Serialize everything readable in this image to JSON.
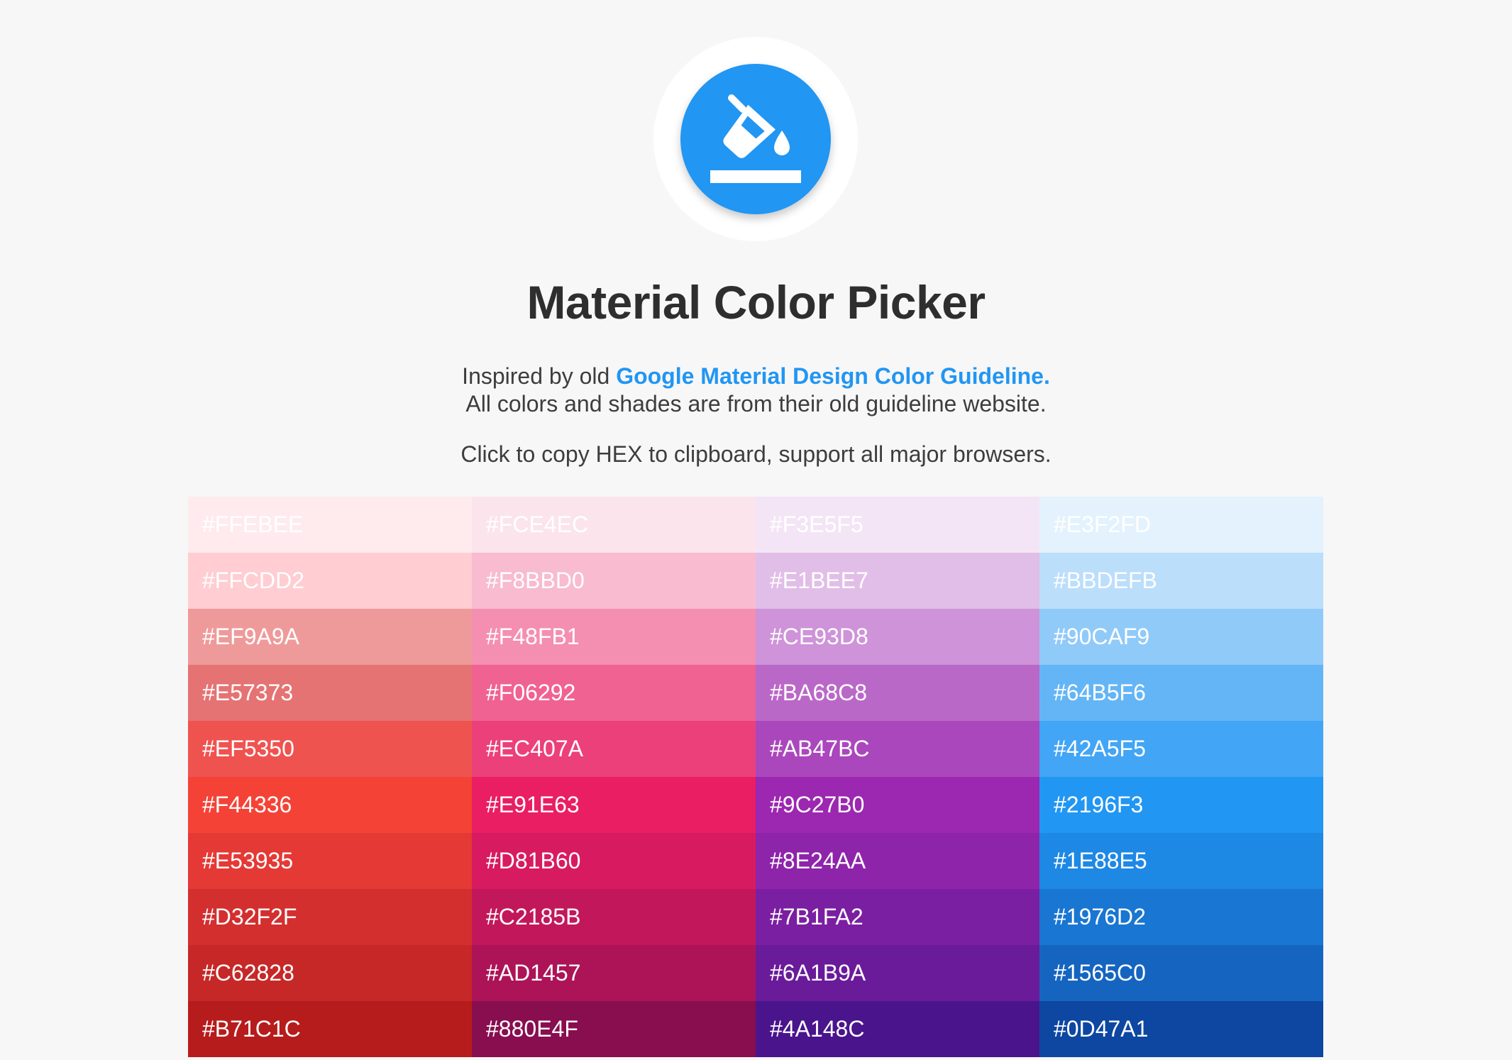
{
  "header": {
    "title": "Material Color Picker",
    "intro_prefix": "Inspired by old ",
    "link_text": "Google Material Design Color Guideline.",
    "line2": "All colors and shades are from their old guideline website.",
    "line3": "Click to copy HEX to clipboard, support all major browsers.",
    "logo_icon": "format-color-fill-icon",
    "logo_color": "#2196F3",
    "link_color": "#2196F3"
  },
  "palette": {
    "columns": [
      {
        "name": "red",
        "swatches": [
          "#FFEBEE",
          "#FFCDD2",
          "#EF9A9A",
          "#E57373",
          "#EF5350",
          "#F44336",
          "#E53935",
          "#D32F2F",
          "#C62828",
          "#B71C1C"
        ]
      },
      {
        "name": "pink",
        "swatches": [
          "#FCE4EC",
          "#F8BBD0",
          "#F48FB1",
          "#F06292",
          "#EC407A",
          "#E91E63",
          "#D81B60",
          "#C2185B",
          "#AD1457",
          "#880E4F"
        ]
      },
      {
        "name": "purple",
        "swatches": [
          "#F3E5F5",
          "#E1BEE7",
          "#CE93D8",
          "#BA68C8",
          "#AB47BC",
          "#9C27B0",
          "#8E24AA",
          "#7B1FA2",
          "#6A1B9A",
          "#4A148C"
        ]
      },
      {
        "name": "blue",
        "swatches": [
          "#E3F2FD",
          "#BBDEFB",
          "#90CAF9",
          "#64B5F6",
          "#42A5F5",
          "#2196F3",
          "#1E88E5",
          "#1976D2",
          "#1565C0",
          "#0D47A1"
        ]
      }
    ]
  }
}
